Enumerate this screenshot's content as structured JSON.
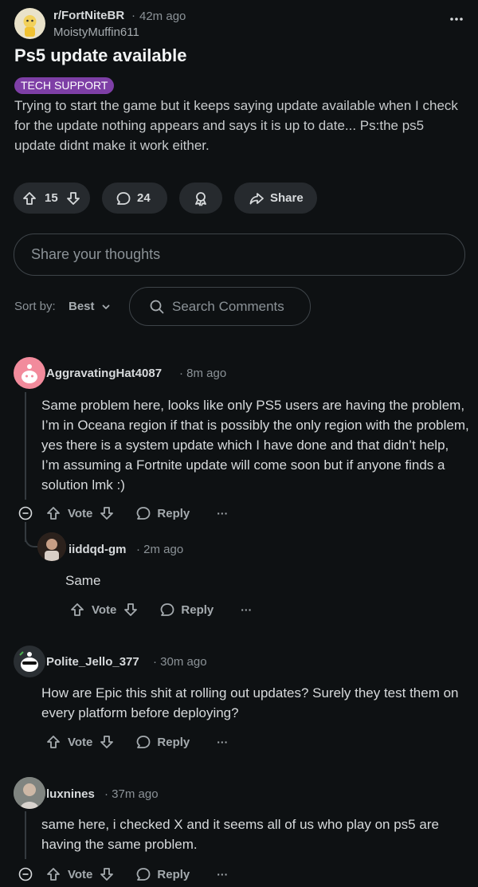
{
  "post": {
    "subreddit": "r/FortNiteBR",
    "time": "42m ago",
    "author": "MoistyMuffin611",
    "title": "Ps5 update available",
    "flair": "TECH SUPPORT",
    "body": "Trying to start the game but it keeps saying update available when I check for the update nothing appears and says it is up to date... Ps:the ps5 update didnt make it work either.",
    "upvotes": "15",
    "comments": "24",
    "share_label": "Share",
    "menu_glyph": "•••"
  },
  "composer": {
    "placeholder": "Share your thoughts"
  },
  "sort": {
    "label": "Sort by:",
    "value": "Best",
    "search_placeholder": "Search Comments"
  },
  "actions": {
    "vote": "Vote",
    "reply": "Reply",
    "more": "···"
  },
  "comments": [
    {
      "user": "AggravatingHat4087",
      "time": "8m ago",
      "body": "Same problem here, looks like only PS5 users are having the problem, I’m in Oceana region if that is possibly the only region with the problem, yes there is a system update which I have done and that didn’t help, I’m assuming a Fortnite update will come soon but if anyone finds a solution lmk :)"
    },
    {
      "user": "iiddqd-gm",
      "time": "2m ago",
      "body": "Same"
    },
    {
      "user": "Polite_Jello_377",
      "time": "30m ago",
      "body": "How are Epic this shit at rolling out updates? Surely they test them on every platform before deploying?"
    },
    {
      "user": "luxnines",
      "time": "37m ago",
      "body": "same here, i checked X and it seems all of us who play on ps5 are having the same problem."
    }
  ],
  "colors": {
    "background": "#0e1113",
    "pill": "#262a2e",
    "flair": "#7e3fa6",
    "text": "#d7dadc",
    "muted": "#8b9297"
  }
}
